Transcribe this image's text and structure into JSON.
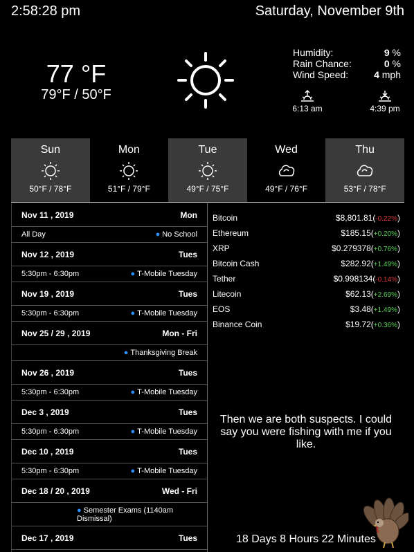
{
  "header": {
    "time": "2:58:28 pm",
    "date": "Saturday, November 9th"
  },
  "current": {
    "temp": "77 °F",
    "hilo": "79°F / 50°F",
    "icon": "sun-icon",
    "stats": [
      {
        "label": "Humidity:",
        "value": "9",
        "unit": "%"
      },
      {
        "label": "Rain Chance:",
        "value": "0",
        "unit": "%"
      },
      {
        "label": "Wind Speed:",
        "value": "4",
        "unit": "mph"
      }
    ],
    "sunrise": "6:13 am",
    "sunset": "4:39 pm"
  },
  "forecast": [
    {
      "day": "Sun",
      "range": "50°F / 78°F",
      "icon": "sun-icon"
    },
    {
      "day": "Mon",
      "range": "51°F / 79°F",
      "icon": "sun-icon"
    },
    {
      "day": "Tue",
      "range": "49°F / 75°F",
      "icon": "sun-icon"
    },
    {
      "day": "Wed",
      "range": "49°F / 76°F",
      "icon": "cloud-icon"
    },
    {
      "day": "Thu",
      "range": "53°F / 78°F",
      "icon": "cloud-icon"
    }
  ],
  "calendar": [
    {
      "date": "Nov 11 , 2019",
      "dow": "Mon",
      "event_time": "All Day",
      "event": "No School"
    },
    {
      "date": "Nov 12 , 2019",
      "dow": "Tues",
      "event_time": "5:30pm - 6:30pm",
      "event": "T-Mobile Tuesday"
    },
    {
      "date": "Nov 19 , 2019",
      "dow": "Tues",
      "event_time": "5:30pm - 6:30pm",
      "event": "T-Mobile Tuesday"
    },
    {
      "date": "Nov 25 / 29 , 2019",
      "dow": "Mon - Fri",
      "event_time": "",
      "event": "Thanksgiving Break"
    },
    {
      "date": "Nov 26 , 2019",
      "dow": "Tues",
      "event_time": "5:30pm - 6:30pm",
      "event": "T-Mobile Tuesday"
    },
    {
      "date": "Dec 3 , 2019",
      "dow": "Tues",
      "event_time": "5:30pm - 6:30pm",
      "event": "T-Mobile Tuesday"
    },
    {
      "date": "Dec 10 , 2019",
      "dow": "Tues",
      "event_time": "5:30pm - 6:30pm",
      "event": "T-Mobile Tuesday"
    },
    {
      "date": "Dec 18 / 20 , 2019",
      "dow": "Wed - Fri",
      "event_time": "",
      "event": "Semester Exams (1140am Dismissal)"
    },
    {
      "date": "Dec 17 , 2019",
      "dow": "Tues",
      "event_time": "",
      "event": ""
    }
  ],
  "crypto": [
    {
      "name": "Bitcoin",
      "price": "$8,801.81",
      "change": "-0.22%",
      "dir": "neg"
    },
    {
      "name": "Ethereum",
      "price": "$185.15",
      "change": "+0.20%",
      "dir": "pos"
    },
    {
      "name": "XRP",
      "price": "$0.279378",
      "change": "+0.76%",
      "dir": "pos"
    },
    {
      "name": "Bitcoin Cash",
      "price": "$282.92",
      "change": "+1.49%",
      "dir": "pos"
    },
    {
      "name": "Tether",
      "price": "$0.998134",
      "change": "-0.14%",
      "dir": "neg"
    },
    {
      "name": "Litecoin",
      "price": "$62.13",
      "change": "+2.69%",
      "dir": "pos"
    },
    {
      "name": "EOS",
      "price": "$3.48",
      "change": "+1.49%",
      "dir": "pos"
    },
    {
      "name": "Binance Coin",
      "price": "$19.72",
      "change": "+0.36%",
      "dir": "pos"
    }
  ],
  "quote": "Then we are both suspects. I could say you were fishing with me if you like.",
  "countdown": "18 Days 8 Hours 22 Minutes",
  "colors": {
    "accent": "#2e8fff",
    "negative": "#e03a3a",
    "positive": "#5bd05b",
    "panel": "#3a3a3a"
  }
}
